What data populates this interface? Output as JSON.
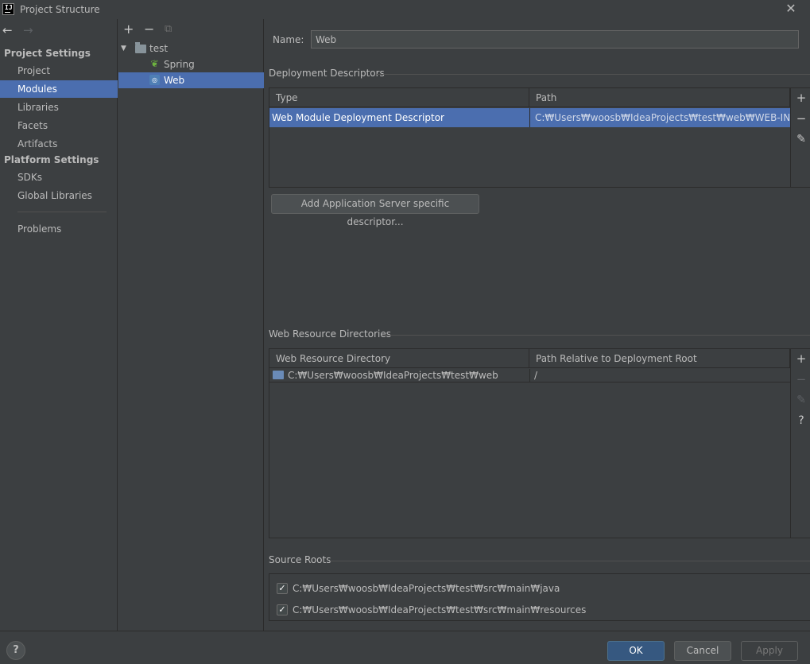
{
  "window": {
    "title": "Project Structure",
    "logo_text": "IJ",
    "close_glyph": "✕"
  },
  "nav": {
    "back_icon": "←",
    "forward_icon": "→",
    "groups": [
      {
        "title": "Project Settings",
        "items": [
          "Project",
          "Modules",
          "Libraries",
          "Facets",
          "Artifacts"
        ]
      },
      {
        "title": "Platform Settings",
        "items": [
          "SDKs",
          "Global Libraries"
        ]
      }
    ],
    "selected": "Modules",
    "problems": "Problems"
  },
  "tree": {
    "add_icon": "+",
    "remove_icon": "−",
    "copy_icon": "⧉",
    "toggle_icon": "▼",
    "nodes": [
      {
        "label": "test",
        "icon": "module-folder-icon"
      },
      {
        "label": "Spring",
        "icon": "spring-leaf-icon"
      },
      {
        "label": "Web",
        "icon": "web-facet-icon"
      }
    ],
    "selected": "Web"
  },
  "main": {
    "name_label": "Name:",
    "name_value": "Web",
    "deployment": {
      "title": "Deployment Descriptors",
      "columns": [
        "Type",
        "Path"
      ],
      "rows": [
        {
          "type": "Web Module Deployment Descriptor",
          "path": "C:₩Users₩woosb₩IdeaProjects₩test₩web₩WEB-INF₩web.x"
        }
      ],
      "tools": {
        "add": "+",
        "remove": "−",
        "edit": "✎"
      },
      "add_server_button": "Add Application Server specific descriptor..."
    },
    "web_resources": {
      "title": "Web Resource Directories",
      "columns": [
        "Web Resource Directory",
        "Path Relative to Deployment Root"
      ],
      "rows": [
        {
          "directory": "C:₩Users₩woosb₩IdeaProjects₩test₩web",
          "relative": "/"
        }
      ],
      "tools": {
        "add": "+",
        "remove": "−",
        "edit": "✎",
        "help": "?"
      }
    },
    "source_roots": {
      "title": "Source Roots",
      "items": [
        {
          "path": "C:₩Users₩woosb₩IdeaProjects₩test₩src₩main₩java",
          "checked": true
        },
        {
          "path": "C:₩Users₩woosb₩IdeaProjects₩test₩src₩main₩resources",
          "checked": true
        }
      ],
      "check_glyph": "✓"
    }
  },
  "footer": {
    "help": "?",
    "ok": "OK",
    "cancel": "Cancel",
    "apply": "Apply"
  },
  "colors": {
    "background": "#3c3f41",
    "selection": "#4b6eaf",
    "primary_button": "#365880",
    "text": "#bbbbbb"
  }
}
